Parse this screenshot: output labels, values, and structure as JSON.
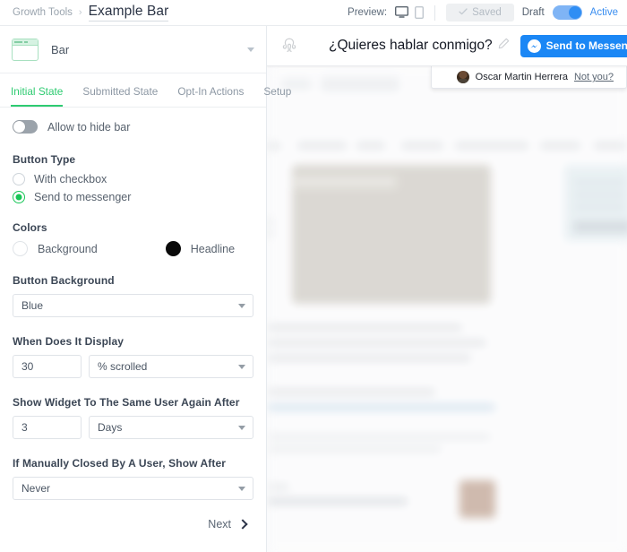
{
  "header": {
    "breadcrumb_parent": "Growth Tools",
    "breadcrumb_separator": "›",
    "page_title": "Example Bar",
    "preview_label": "Preview:",
    "preview_desktop_icon": "desktop-monitor-icon",
    "preview_mobile_icon": "mobile-phone-icon",
    "saved_button_label": "Saved",
    "saved_check_icon": "check-icon",
    "draft_label": "Draft",
    "active_label": "Active",
    "status_toggle_on": true,
    "toggle_color": "#2f8ef4",
    "active_text_color": "#3a8ef0"
  },
  "widget_selector": {
    "icon": "bar-widget-icon",
    "name": "Bar",
    "caret_icon": "chevron-down-icon"
  },
  "tabs": [
    {
      "label": "Initial State",
      "active": true
    },
    {
      "label": "Submitted State",
      "active": false
    },
    {
      "label": "Opt-In Actions",
      "active": false
    },
    {
      "label": "Setup",
      "active": false
    }
  ],
  "tab_active_color": "#2ecb71",
  "form": {
    "allow_hide_bar": {
      "label": "Allow to hide bar",
      "enabled": false
    },
    "button_type": {
      "label": "Button Type",
      "options": [
        {
          "label": "With checkbox",
          "selected": false
        },
        {
          "label": "Send to messenger",
          "selected": true
        }
      ]
    },
    "colors": {
      "label": "Colors",
      "items": [
        {
          "label": "Background",
          "value": "#ffffff"
        },
        {
          "label": "Headline",
          "value": "#0a0a0a"
        }
      ]
    },
    "button_background": {
      "label": "Button Background",
      "value": "Blue"
    },
    "when_display": {
      "label": "When Does It Display",
      "amount": "30",
      "unit": "% scrolled"
    },
    "show_again_after": {
      "label": "Show Widget To The Same User Again After",
      "amount": "3",
      "unit": "Days"
    },
    "if_closed_show_after": {
      "label": "If Manually Closed By A User, Show After",
      "value": "Never"
    },
    "next_button": {
      "label": "Next",
      "icon": "chevron-right-icon"
    }
  },
  "preview": {
    "logo_icon": "manychat-octopus-icon",
    "headline": "¿Quieres hablar conmigo?",
    "edit_icon": "pencil-edit-icon",
    "send_button": {
      "label": "Send to Messenger",
      "icon": "messenger-icon",
      "color": "#1b87f5"
    },
    "identity": {
      "avatar": "user-avatar",
      "name": "Oscar Martin Herrera",
      "not_you_label": "Not you?"
    }
  }
}
